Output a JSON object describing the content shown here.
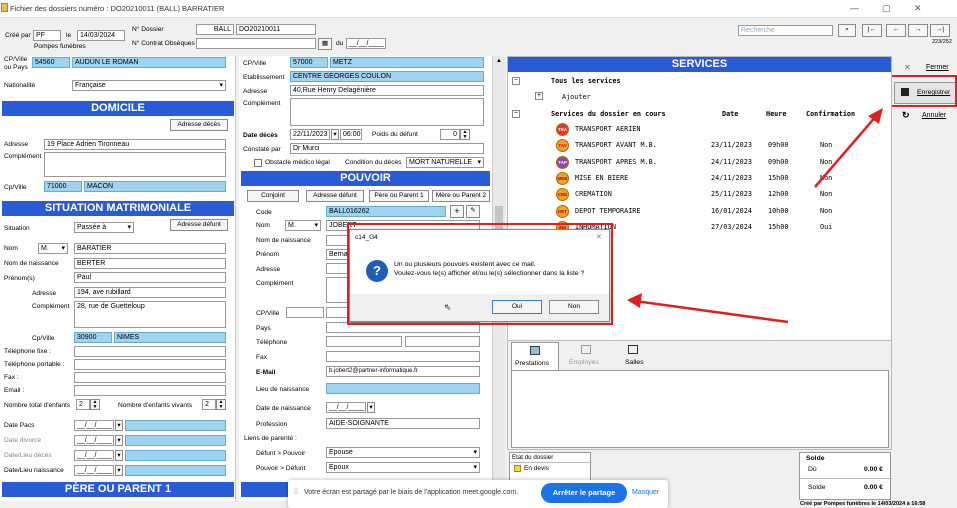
{
  "window": {
    "title": "Fichier des dossiers   numéro : DO20210011 (BALL) BARRATIER",
    "ctl_min": "—",
    "ctl_max": "▢",
    "ctl_close": "✕"
  },
  "top": {
    "cree_par_label": "Créé par",
    "cree_par": "PF",
    "le_label": "le",
    "date": "14/03/2024",
    "pompes": "Pompes funèbres",
    "dossier_label": "N° Dossier",
    "dossier_name": "BALL",
    "dossier_num": "DO20210011",
    "contrat_label": "N° Contrat Obsèques",
    "du_label": "du",
    "du_date": "__/__/____",
    "search_ph": "Recherche",
    "counter": "223/252"
  },
  "right_buttons": {
    "fermer": "Fermer",
    "enregistrer": "Enregistrer",
    "annuler": "Annuler"
  },
  "left": {
    "cp_label": "CP/Ville\nou Pays",
    "cp": "54560",
    "ville": "AUDUN LE ROMAN",
    "nat_label": "Nationalité",
    "nat": "Française",
    "domicile": "DOMICILE",
    "adresse_deces": "Adresse décès",
    "adresse_label": "Adresse",
    "adresse": "19 Place Adrien Tironneau",
    "complement_label": "Complément",
    "cpville_label": "Cp/Ville",
    "cp2": "71000",
    "ville2": "MACON",
    "sitmat": "SITUATION MATRIMONIALE",
    "situation_label": "Situation",
    "situation": "Passée à",
    "adresse_defunt": "Adresse défunt",
    "nom_label": "Nom",
    "civ": "M.",
    "nom": "BARATIER",
    "naissance_label": "Nom de naissance",
    "naissance": "BERTER",
    "prenom_label": "Prénom(s)",
    "prenom": "Paul",
    "adr_label": "Adresse",
    "adr": "194, ave rubillard",
    "comp_label": "Complément",
    "comp": "28, rue de Guetteloup",
    "cpv_label": "Cp/Ville",
    "cp3": "30900",
    "ville3": "NIMES",
    "tel_fixe": "Téléphone fixe :",
    "tel_port": "Téléphone portable :",
    "fax": "Fax :",
    "email": "Email :",
    "nb_enf": "Nombre total d'enfants",
    "nb_enf_v": "2",
    "nb_viv": "Nombre d'enfants vivants",
    "nb_viv_v": "2",
    "pacs": "Date Pacs",
    "divorce": "Date divorce",
    "lieu_deces": "Date/Lieu décès",
    "lieu_naiss": "Date/Lieu naissance",
    "date_empty": "__/__/____",
    "pere": "PÈRE OU PARENT 1"
  },
  "mid": {
    "cp_label": "CP/Ville",
    "cp": "57000",
    "ville": "METZ",
    "etab_label": "Etablissement",
    "etab": "CENTRE GEORGES COULON",
    "adr_label": "Adresse",
    "adr": "40,Rue Henry Delagénière",
    "comp_label": "Complément",
    "date_deces_label": "Date décès",
    "date_deces": "22/11/2023",
    "heure": "06:00",
    "poids_label": "Poids du défunt",
    "poids": "0",
    "constate_label": "Constaté par",
    "constate": "Dr Murci",
    "obstacle": "Obstacle médico légal",
    "condition_label": "Condition du décès",
    "condition": "MORT NATURELLE",
    "pouvoir": "POUVOIR",
    "btn_conjoint": "Conjoint",
    "btn_adr_def": "Adresse défunt",
    "btn_pere": "Père ou Parent 1",
    "btn_mere": "Mère ou Parent 2",
    "code_label": "Code",
    "code": "BALL016262",
    "nom_label": "Nom",
    "civ": "M.",
    "nom": "JOBERT",
    "naiss_label": "Nom de naissance",
    "prenom_label": "Prénom",
    "prenom": "Bernard",
    "adresse_label": "Adresse",
    "complement_label": "Complément",
    "cp_label2": "CP/Ville",
    "pays_label": "Pays",
    "tel_label": "Téléphone",
    "fax_label": "Fax",
    "email_label": "E-Mail",
    "email": "b.jobert2@partner-informatique.fr",
    "lieu_naiss_label": "Lieu de naissance",
    "date_naiss_label": "Date de naissance",
    "date_naiss": "__/__/____",
    "prof_label": "Profession",
    "prof": "AIDE-SOIGNANTE",
    "liens_label": "Liens de parenté :",
    "def_pouv": "Défunt > Pouvoir",
    "def_pouv_v": "Epouse",
    "pouv_def": "Pouvoir > Défunt",
    "pouv_def_v": "Epoux"
  },
  "services": {
    "title": "SERVICES",
    "tous": "Tous les services",
    "ajouter": "Ajouter",
    "col_svc": "Services du dossier en cours",
    "col_date": "Date",
    "col_heure": "Heure",
    "col_conf": "Confirmation",
    "rows": [
      {
        "badge": "TRA",
        "name": "TRANSPORT AERIEN",
        "date": "",
        "heure": "",
        "conf": ""
      },
      {
        "badge": "TAV",
        "name": "TRANSPORT AVANT M.B.",
        "date": "23/11/2023",
        "heure": "09h00",
        "conf": "Non"
      },
      {
        "badge": "TAP",
        "name": "TRANSPORT APRES M.B.",
        "date": "24/11/2023",
        "heure": "09h00",
        "conf": "Non"
      },
      {
        "badge": "MEB",
        "name": "MISE EN BIERE",
        "date": "24/11/2023",
        "heure": "15h00",
        "conf": "Non"
      },
      {
        "badge": "CRE",
        "name": "CREMATION",
        "date": "25/11/2023",
        "heure": "12h00",
        "conf": "Non"
      },
      {
        "badge": "DET",
        "name": "DEPOT TEMPORAIRE",
        "date": "16/01/2024",
        "heure": "10h00",
        "conf": "Non"
      },
      {
        "badge": "INH",
        "name": "INHUMATION",
        "date": "27/03/2024",
        "heure": "15h00",
        "conf": "Oui"
      }
    ],
    "tab_prest": "Prestations",
    "tab_empl": "Employés",
    "tab_salles": "Salles",
    "etat_label": "Etat du dossier",
    "etat": "En devis",
    "solde_title": "Solde",
    "du_label": "Dû",
    "du": "0.00 €",
    "solde_label": "Solde",
    "solde": "0.00 €"
  },
  "dialog": {
    "title": "c14_G4",
    "close": "✕",
    "line1": "Un ou plusieurs pouvoirs existent avec ce mail.",
    "line2": "Voulez-vous le(s) afficher et/ou le(s) sélectionner dans la liste ?",
    "oui": "Oui",
    "non": "Non"
  },
  "share": {
    "text": "Votre écran est partagé par le biais de l'application meet.google.com.",
    "stop": "Arrêter le partage",
    "hide": "Masquer"
  },
  "footer": {
    "text": "Créé par Pompes funèbres le 14/03/2024 à 16:58"
  },
  "colors": {
    "header_blue": "#2a5bd7",
    "field_blue": "#9fd3f2",
    "annotation_red": "#e02020"
  }
}
